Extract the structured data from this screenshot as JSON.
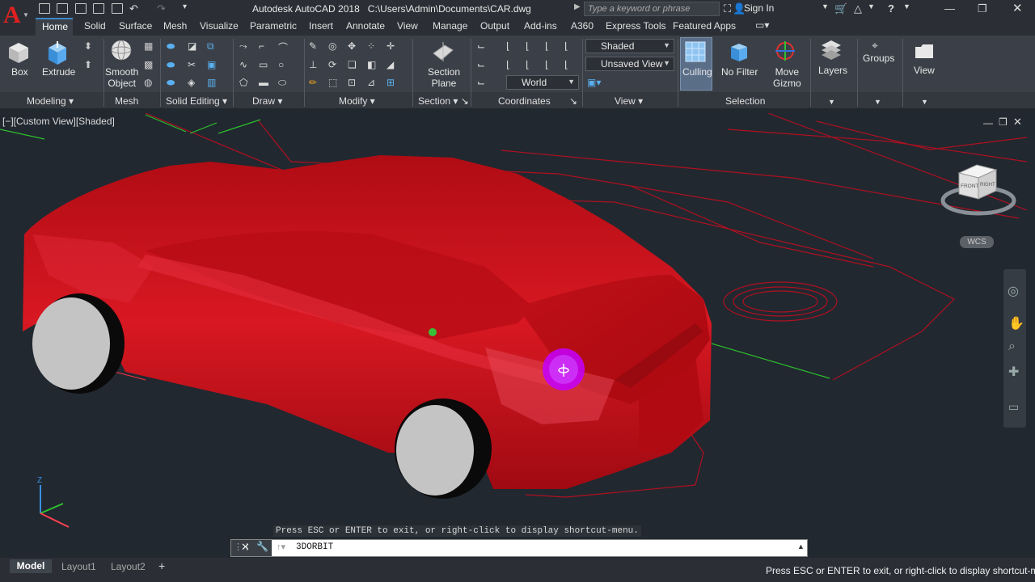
{
  "titlebar": {
    "app_name": "Autodesk AutoCAD 2018",
    "file_path": "C:\\Users\\Admin\\Documents\\CAR.dwg",
    "search_placeholder": "Type a keyword or phrase",
    "signin": "Sign In"
  },
  "tabs": [
    "Home",
    "Solid",
    "Surface",
    "Mesh",
    "Visualize",
    "Parametric",
    "Insert",
    "Annotate",
    "View",
    "Manage",
    "Output",
    "Add-ins",
    "A360",
    "Express Tools",
    "Featured Apps"
  ],
  "ribbon": {
    "box": "Box",
    "extrude": "Extrude",
    "smooth_object": [
      "Smooth",
      "Object"
    ],
    "section_plane": [
      "Section",
      "Plane"
    ],
    "visual_style": "Shaded",
    "saved_view": "Unsaved View",
    "ucs": "World",
    "culling": "Culling",
    "no_filter": "No Filter",
    "move_gizmo": [
      "Move",
      "Gizmo"
    ],
    "layers": "Layers",
    "groups": "Groups",
    "view": "View",
    "panels": [
      "Modeling",
      "Mesh",
      "Solid Editing",
      "Draw",
      "Modify",
      "Section",
      "Coordinates",
      "View",
      "Selection"
    ]
  },
  "viewport": {
    "label": "[−][Custom View][Shaded]",
    "wcs": "WCS",
    "cube_front": "FRONT",
    "cube_right": "RIGHT"
  },
  "command": {
    "message": "Press ESC or ENTER to exit, or right-click to display shortcut-menu.",
    "input": "3DORBIT"
  },
  "layout_tabs": [
    "Model",
    "Layout1",
    "Layout2"
  ],
  "status": {
    "message": "Press ESC or ENTER to exit, or right-click to display shortcut-menu"
  },
  "colors": {
    "car_body": "#c8101a",
    "wheel": "#c4c4c4",
    "orbit_cursor": "#c400ff",
    "accent": "#3b88c8"
  }
}
